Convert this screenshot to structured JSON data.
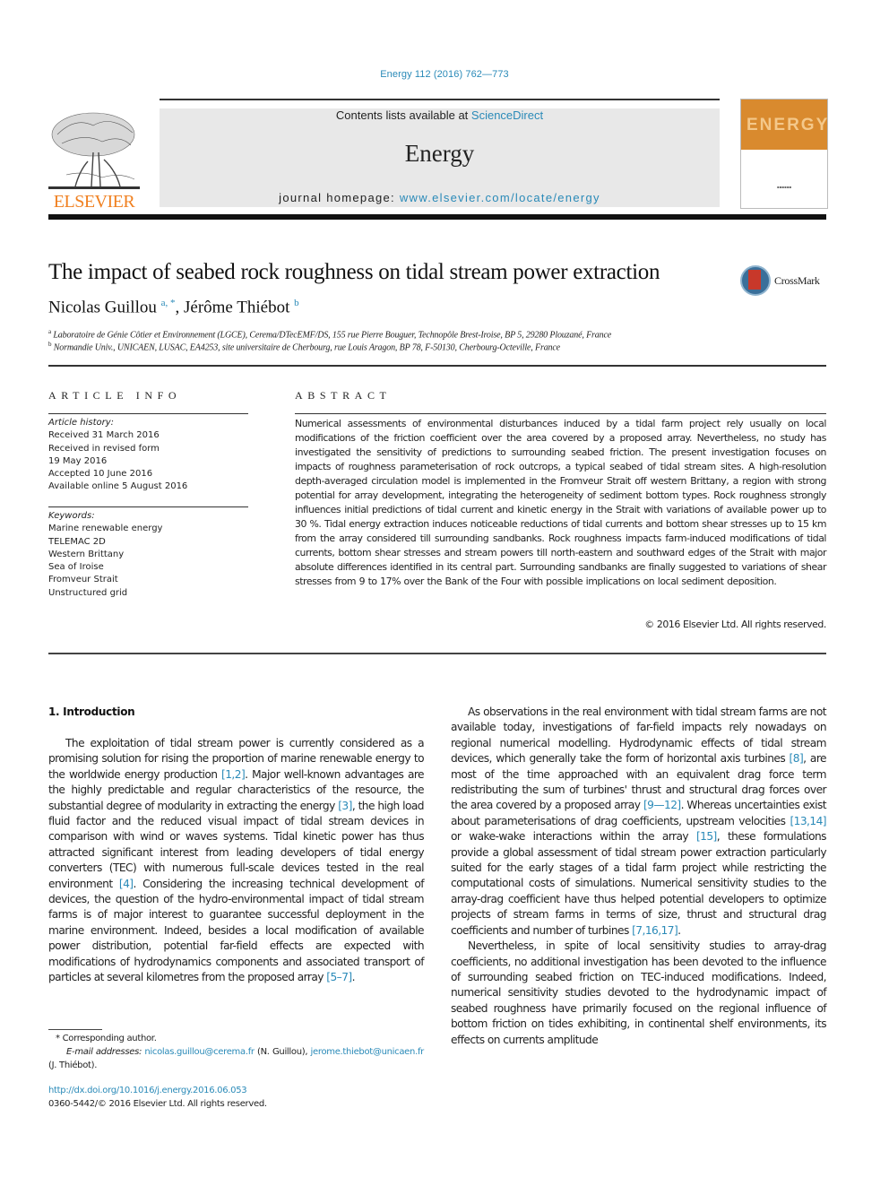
{
  "header": {
    "citation": "Energy 112 (2016) 762—773",
    "contents_prefix": "Contents lists available at ",
    "contents_link": "ScienceDirect",
    "journal_name": "Energy",
    "homepage_prefix": "journal homepage: ",
    "homepage_link": "www.elsevier.com/locate/energy",
    "publisher_logo": "ELSEVIER",
    "cover_word": "ENERGY",
    "colors": {
      "link": "#2a8ab8",
      "elsevier_orange": "#f08020",
      "cover_orange": "#d98a2e"
    }
  },
  "article": {
    "title": "The impact of seabed rock roughness on tidal stream power extraction",
    "crossmark_label": "CrossMark",
    "authors": [
      {
        "name": "Nicolas Guillou",
        "sup": "a, *"
      },
      {
        "name": "Jérôme Thiébot",
        "sup": "b"
      }
    ],
    "affiliations": [
      {
        "key": "a",
        "text": "Laboratoire de Génie Côtier et Environnement (LGCE), Cerema/DTecEMF/DS, 155 rue Pierre Bouguer, Technopôle Brest-Iroise, BP 5, 29280 Plouzané, France"
      },
      {
        "key": "b",
        "text": "Normandie Univ., UNICAEN, LUSAC, EA4253, site universitaire de Cherbourg, rue Louis Aragon, BP 78, F-50130, Cherbourg-Octeville, France"
      }
    ]
  },
  "article_info": {
    "heading": "ARTICLE INFO",
    "history_label": "Article history:",
    "history": [
      "Received 31 March 2016",
      "Received in revised form",
      "19 May 2016",
      "Accepted 10 June 2016",
      "Available online 5 August 2016"
    ],
    "keywords_label": "Keywords:",
    "keywords": [
      "Marine renewable energy",
      "TELEMAC 2D",
      "Western Brittany",
      "Sea of Iroise",
      "Fromveur Strait",
      "Unstructured grid"
    ]
  },
  "abstract": {
    "heading": "ABSTRACT",
    "text": "Numerical assessments of environmental disturbances induced by a tidal farm project rely usually on local modifications of the friction coefficient over the area covered by a proposed array. Nevertheless, no study has investigated the sensitivity of predictions to surrounding seabed friction. The present investigation focuses on impacts of roughness parameterisation of rock outcrops, a typical seabed of tidal stream sites. A high-resolution depth-averaged circulation model is implemented in the Fromveur Strait off western Brittany, a region with strong potential for array development, integrating the heterogeneity of sediment bottom types. Rock roughness strongly influences initial predictions of tidal current and kinetic energy in the Strait with variations of available power up to 30 %. Tidal energy extraction induces noticeable reductions of tidal currents and bottom shear stresses up to 15 km from the array considered till surrounding sandbanks. Rock roughness impacts farm-induced modifications of tidal currents, bottom shear stresses and stream powers till north-eastern and southward edges of the Strait with major absolute differences identified in its central part. Surrounding sandbanks are finally suggested to variations of shear stresses from 9 to 17% over the Bank of the Four with possible implications on local sediment deposition.",
    "copyright": "© 2016 Elsevier Ltd. All rights reserved."
  },
  "body": {
    "section_heading": "1.  Introduction",
    "left_paragraphs": [
      [
        {
          "t": "The exploitation of tidal stream power is currently considered as a promising solution for rising the proportion of marine renewable energy to the worldwide energy production "
        },
        {
          "ref": "[1,2]"
        },
        {
          "t": ". Major well-known advantages are the highly predictable and regular characteristics of the resource, the substantial degree of modularity in extracting the energy "
        },
        {
          "ref": "[3]"
        },
        {
          "t": ", the high load fluid factor and the reduced visual impact of tidal stream devices in comparison with wind or waves systems. Tidal kinetic power has thus attracted significant interest from leading developers of tidal energy converters (TEC) with numerous full-scale devices tested in the real environment "
        },
        {
          "ref": "[4]"
        },
        {
          "t": ". Considering the increasing technical development of devices, the question of the hydro-environmental impact of tidal stream farms is of major interest to guarantee successful deployment in the marine environment. Indeed, besides a local modification of available power distribution, potential far-field effects are expected with modifications of hydrodynamics components and associated transport of particles at several kilometres from the proposed array "
        },
        {
          "ref": "[5–7]"
        },
        {
          "t": "."
        }
      ]
    ],
    "right_paragraphs": [
      [
        {
          "t": "As observations in the real environment with tidal stream farms are not available today, investigations of far-field impacts rely nowadays on regional numerical modelling. Hydrodynamic effects of tidal stream devices, which generally take the form of horizontal axis turbines "
        },
        {
          "ref": "[8]"
        },
        {
          "t": ", are most of the time approached with an equivalent drag force term redistributing the sum of turbines' thrust and structural drag forces over the area covered by a proposed array "
        },
        {
          "ref": "[9—12]"
        },
        {
          "t": ". Whereas uncertainties exist about parameterisations of drag coefficients, upstream velocities "
        },
        {
          "ref": "[13,14]"
        },
        {
          "t": " or wake-wake interactions within the array "
        },
        {
          "ref": "[15]"
        },
        {
          "t": ", these formulations provide a global assessment of tidal stream power extraction particularly suited for the early stages of a tidal farm project while restricting the computational costs of simulations. Numerical sensitivity studies to the array-drag coefficient have thus helped potential developers to optimize projects of stream farms in terms of size, thrust and structural drag coefficients and number of turbines "
        },
        {
          "ref": "[7,16,17]"
        },
        {
          "t": "."
        }
      ],
      [
        {
          "t": "Nevertheless, in spite of local sensitivity studies to array-drag coefficients, no additional investigation has been devoted to the influence of surrounding seabed friction on TEC-induced modifications. Indeed, numerical sensitivity studies devoted to the hydrodynamic impact of seabed roughness have primarily focused on the regional influence of bottom friction on tides exhibiting, in continental shelf environments, its effects on currents amplitude"
        }
      ]
    ]
  },
  "footnotes": {
    "corresponding": "* Corresponding author.",
    "email_label": "E-mail addresses:",
    "email1": "nicolas.guillou@cerema.fr",
    "email1_owner": " (N. Guillou), ",
    "email2": "jerome.thiebot@unicaen.fr",
    "email2_owner": " (J. Thiébot).",
    "doi": "http://dx.doi.org/10.1016/j.energy.2016.06.053",
    "issn": "0360-5442/© 2016 Elsevier Ltd. All rights reserved."
  }
}
